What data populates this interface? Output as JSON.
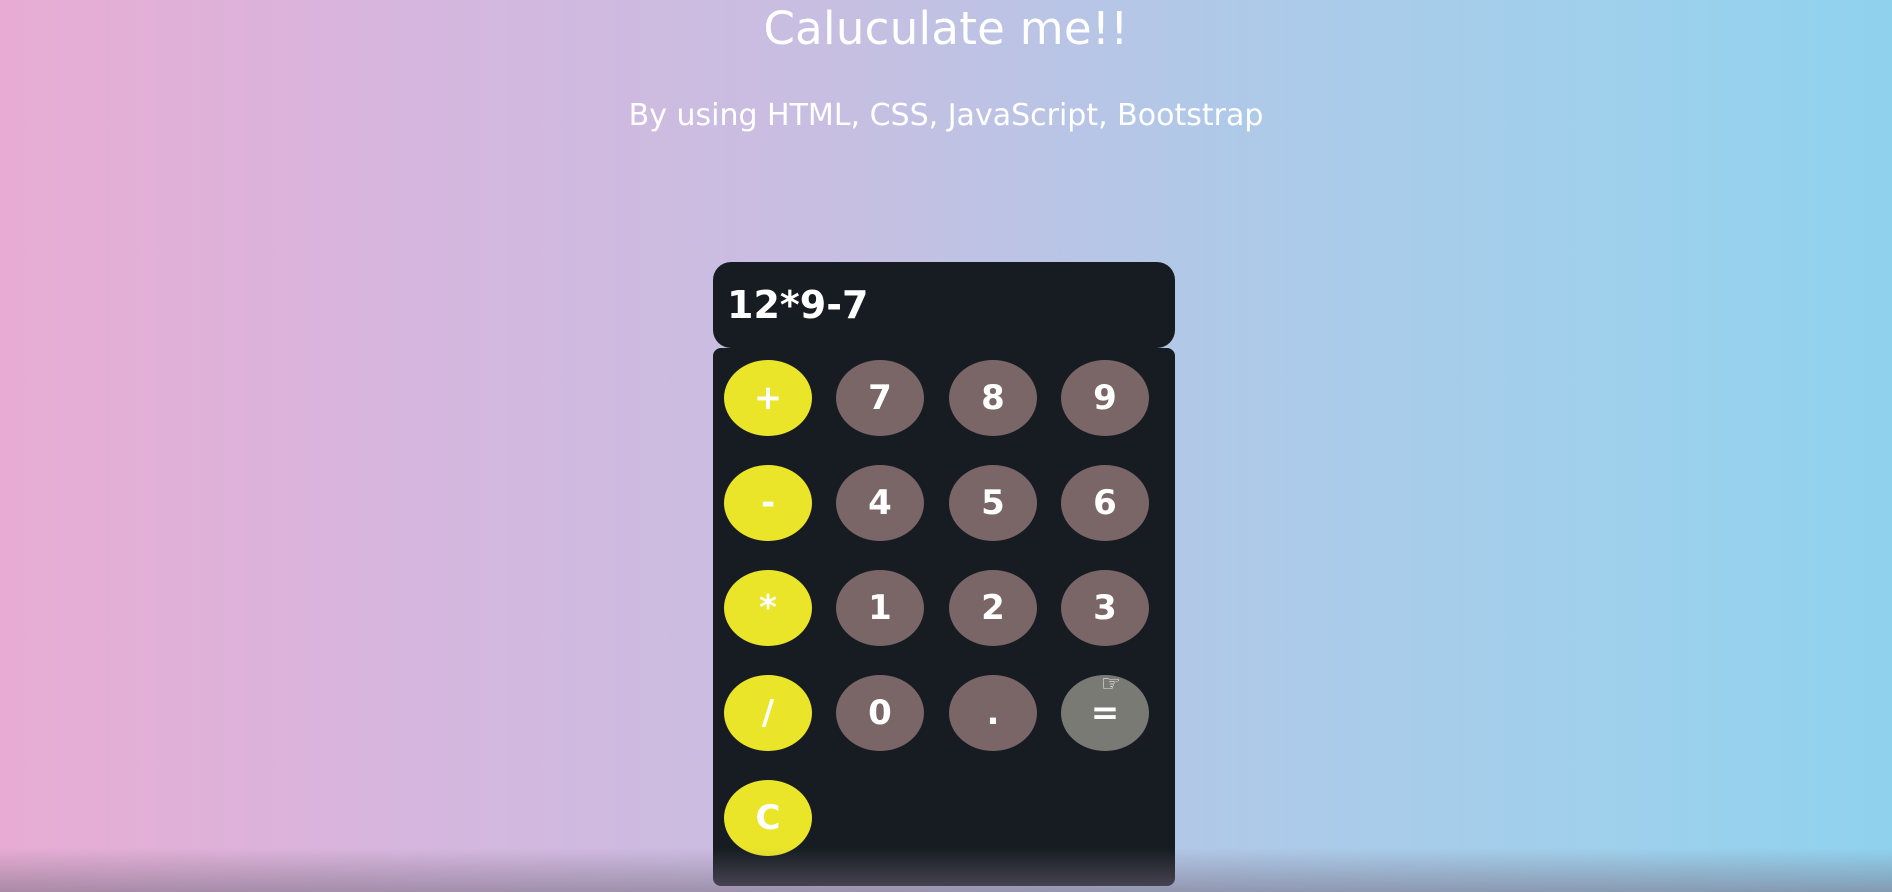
{
  "header": {
    "title": "Caluculate me!!",
    "subtitle": "By using HTML, CSS, JavaScript, Bootstrap"
  },
  "display": {
    "value": "12*9-7"
  },
  "keypad": {
    "plus": "+",
    "minus": "-",
    "multiply": "*",
    "divide": "/",
    "clear": "C",
    "seven": "7",
    "eight": "8",
    "nine": "9",
    "four": "4",
    "five": "5",
    "six": "6",
    "one": "1",
    "two": "2",
    "three": "3",
    "zero": "0",
    "dot": ".",
    "equals": "="
  },
  "colors": {
    "operator_key": "#eae528",
    "number_key": "#7a6666",
    "panel": "#171c22",
    "background_left": "#e8acd4",
    "background_right": "#8fd2ee"
  }
}
